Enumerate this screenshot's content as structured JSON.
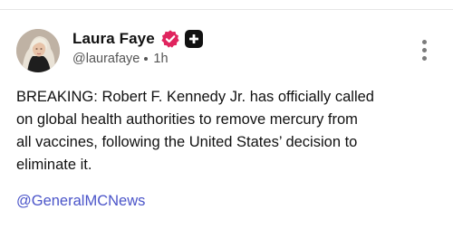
{
  "post": {
    "author": {
      "display_name": "Laura Faye",
      "handle": "@laurafaye",
      "time_ago": "1h",
      "verified": true,
      "badge_color": "#e0245e"
    },
    "body_lines": [
      "BREAKING: Robert F. Kennedy Jr. has officially called",
      "on global health authorities to remove mercury from",
      "all vaccines, following the United States’ decision to",
      "eliminate it."
    ],
    "mention": "@GeneralMCNews",
    "mention_color": "#4a54c9",
    "icons": {
      "verified": "verified-check-icon",
      "plus": "plus-badge-icon",
      "more": "more-vertical-icon"
    }
  }
}
